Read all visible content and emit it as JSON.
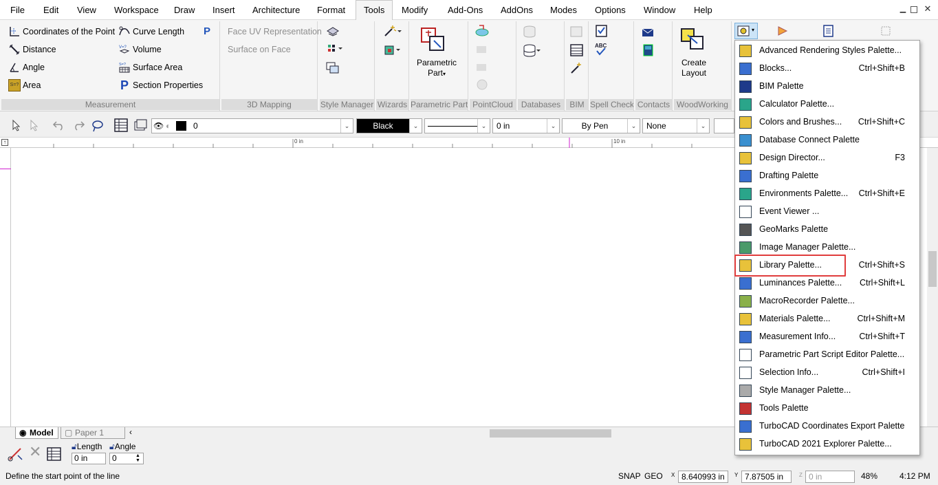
{
  "menu": [
    "File",
    "Edit",
    "View",
    "Workspace",
    "Draw",
    "Insert",
    "Architecture",
    "Format",
    "Tools",
    "Modify",
    "Add-Ons",
    "AddOns",
    "Modes",
    "Options",
    "Window",
    "Help"
  ],
  "active_menu": "Tools",
  "measurement": {
    "coordinates": "Coordinates of the Point",
    "curve_length": "Curve Length",
    "distance": "Distance",
    "volume": "Volume",
    "angle": "Angle",
    "surface_area": "Surface Area",
    "area": "Area",
    "section_properties": "Section Properties",
    "label": "Measurement"
  },
  "mapping3d": {
    "face_uv": "Face UV Representation",
    "surface_on_face": "Surface on Face",
    "label": "3D Mapping"
  },
  "groups": {
    "style_manager": "Style Manager",
    "wizards": "Wizards",
    "parametric_part": "Parametric Part",
    "parametric_part_btn": [
      "Parametric",
      "Part"
    ],
    "pointcloud": "PointCloud",
    "databases": "Databases",
    "bim": "BIM",
    "spell_check": "Spell Check",
    "contacts": "Contacts",
    "woodworking": "WoodWorking",
    "create_layout": [
      "Create",
      "Layout"
    ]
  },
  "props": {
    "layer": "0",
    "color": "Black",
    "width": "0 in",
    "pen": "By Pen",
    "fill": "None"
  },
  "ruler": {
    "zero": "0 in",
    "ten": "10 in"
  },
  "tabs": {
    "model": "Model",
    "paper": "Paper 1"
  },
  "inspector": {
    "length_label": "Length",
    "length_value": "0 in",
    "angle_label": "Angle",
    "angle_value": "0"
  },
  "status": {
    "prompt": "Define the start point of the line",
    "snap": "SNAP",
    "geo": "GEO",
    "x": "8.640993 in",
    "y": "7.87505 in",
    "z": "0 in",
    "zoom": "48%",
    "time": "4:12 PM"
  },
  "palette_menu": [
    {
      "label": "Advanced Rendering Styles Palette...",
      "shortcut": ""
    },
    {
      "label": "Blocks...",
      "shortcut": "Ctrl+Shift+B"
    },
    {
      "label": "BIM Palette",
      "shortcut": ""
    },
    {
      "label": "Calculator Palette...",
      "shortcut": ""
    },
    {
      "label": "Colors and Brushes...",
      "shortcut": "Ctrl+Shift+C"
    },
    {
      "label": "Database Connect Palette",
      "shortcut": ""
    },
    {
      "label": "Design Director...",
      "shortcut": "F3"
    },
    {
      "label": "Drafting Palette",
      "shortcut": ""
    },
    {
      "label": "Environments Palette...",
      "shortcut": "Ctrl+Shift+E"
    },
    {
      "label": "Event Viewer ...",
      "shortcut": ""
    },
    {
      "label": "GeoMarks Palette",
      "shortcut": ""
    },
    {
      "label": "Image Manager Palette...",
      "shortcut": ""
    },
    {
      "label": "Library Palette...",
      "shortcut": "Ctrl+Shift+S"
    },
    {
      "label": "Luminances Palette...",
      "shortcut": "Ctrl+Shift+L"
    },
    {
      "label": "MacroRecorder Palette...",
      "shortcut": ""
    },
    {
      "label": "Materials Palette...",
      "shortcut": "Ctrl+Shift+M"
    },
    {
      "label": "Measurement Info...",
      "shortcut": "Ctrl+Shift+T"
    },
    {
      "label": "Parametric Part Script Editor Palette...",
      "shortcut": ""
    },
    {
      "label": "Selection Info...",
      "shortcut": "Ctrl+Shift+I"
    },
    {
      "label": "Style Manager Palette...",
      "shortcut": ""
    },
    {
      "label": "Tools Palette",
      "shortcut": ""
    },
    {
      "label": "TurboCAD Coordinates Export Palette",
      "shortcut": ""
    },
    {
      "label": "TurboCAD 2021 Explorer Palette...",
      "shortcut": ""
    }
  ],
  "highlighted_item": "Library Palette...",
  "colors": {
    "accent": "#e03c3c",
    "ribbon_bg": "#f5f5f5",
    "group_label_bg": "#dcdcdc"
  }
}
